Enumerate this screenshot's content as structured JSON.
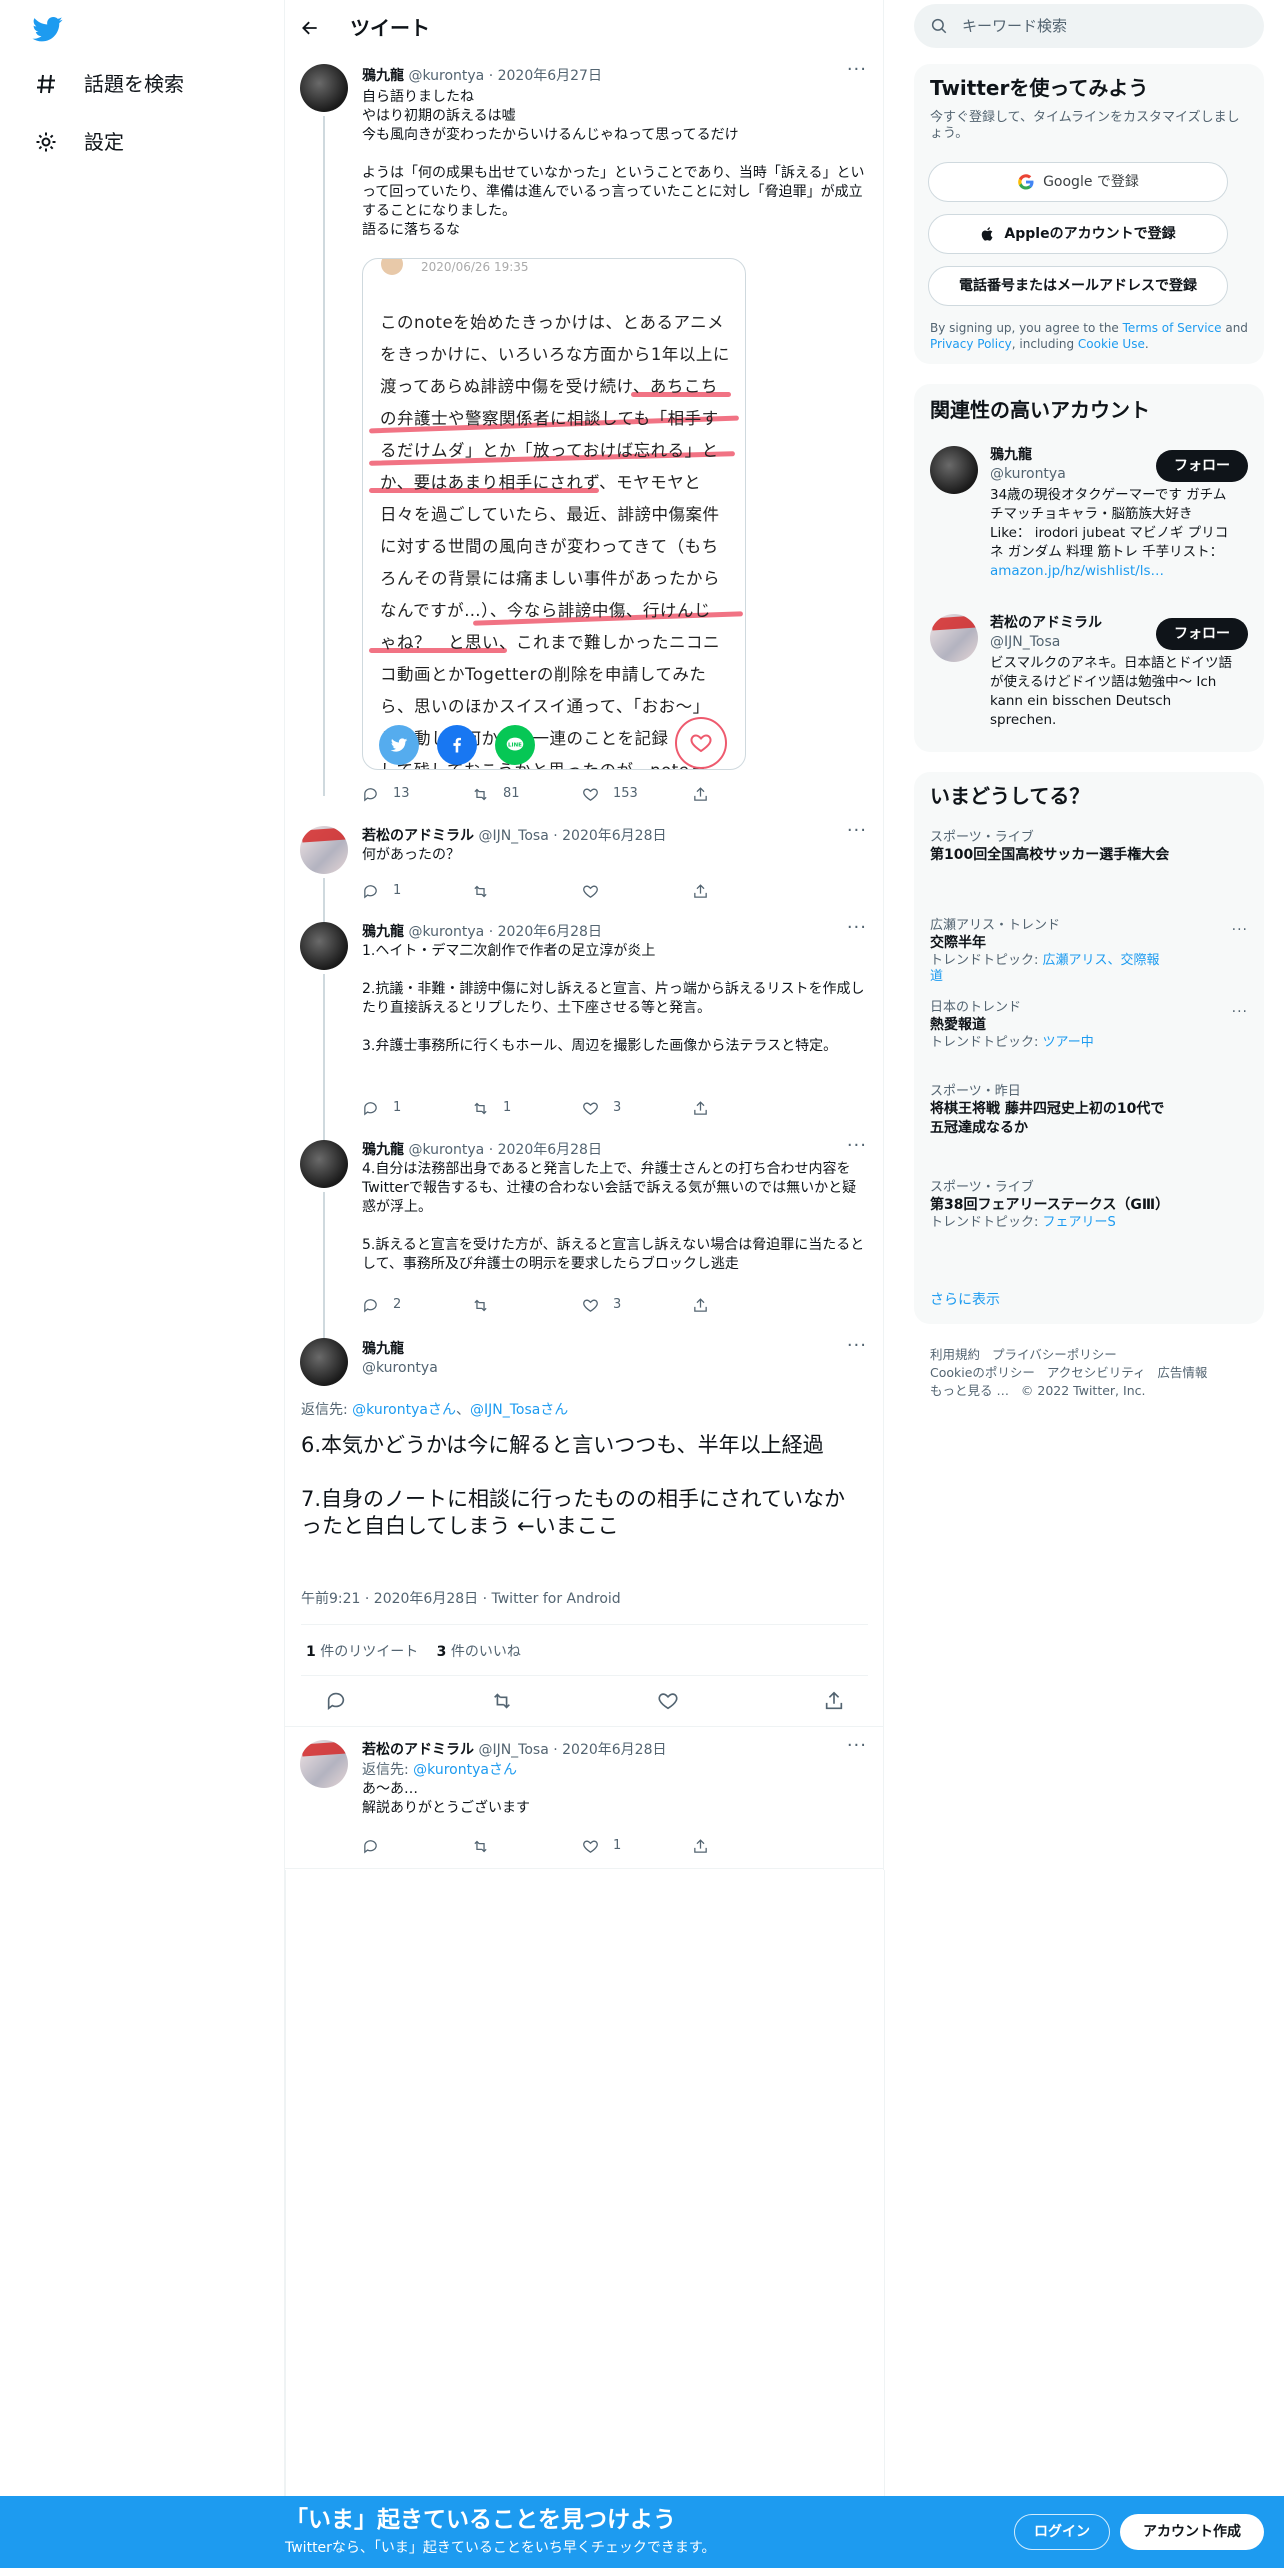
{
  "nav": {
    "explore": "話題を検索",
    "settings": "設定"
  },
  "header": {
    "title": "ツイート"
  },
  "tweet1": {
    "name": "鴉九龍",
    "handle": "@kurontya",
    "date": "· 2020年6月27日",
    "line1": "自ら語りましたね",
    "line2": "やはり初期の訴えるは嘘",
    "line3": "今も風向きが変わったからいけるんじゃねって思ってるだけ",
    "para": "ようは「何の成果も出せていなかった」ということであり、当時「訴える」といって回っていたり、準備は進んでいるっ言っていたことに対し「脅迫罪」が成立することになりました。",
    "para2": "語るに落ちるな",
    "note_date": "2020/06/26 19:35",
    "note_lines": [
      "このnoteを始めたきっかけは、とあるアニメ",
      "をきっかけに、いろいろな方面から1年以上に",
      "渡ってあらぬ誹謗中傷を受け続け、あちこち",
      "の弁護士や警察関係者に相談しても「相手す",
      "るだけムダ」とか「放っておけば忘れる」と",
      "か、要はあまり相手にされず、モヤモヤと",
      "日々を過ごしていたら、最近、誹謗中傷案件",
      "に対する世間の風向きが変わってきて（もち",
      "ろんその背景には痛ましい事件があったから",
      "なんですが…）、今なら誹謗中傷、行けんじ",
      "ゃね？　と思い、これまで難しかったニコニ",
      "コ動画とかTogetterの削除を申請してみた",
      "ら、思いのほかスイスイ通って、「おお〜」",
      "と感動して何かこの一連のことを記録",
      "して残しておこうかと思ったのが、noteを"
    ],
    "reply": "13",
    "retweet": "81",
    "like": "153"
  },
  "tweet2": {
    "name": "若松のアドミラル",
    "handle": "@IJN_Tosa",
    "date": "· 2020年6月28日",
    "text": "何があったの？",
    "reply": "1",
    "retweet": "",
    "like": ""
  },
  "tweet3": {
    "name": "鴉九龍",
    "handle": "@kurontya",
    "date": "· 2020年6月28日",
    "p1": "1.ヘイト・デマ二次創作で作者の足立淳が炎上",
    "p2": "2.抗議・非難・誹謗中傷に対し訴えると宣言、片っ端から訴えるリストを作成したり直接訴えるとリプしたり、土下座させる等と発言。",
    "p3": "3.弁護士事務所に行くもホール、周辺を撮影した画像から法テラスと特定。",
    "reply": "1",
    "retweet": "1",
    "like": "3"
  },
  "tweet4": {
    "name": "鴉九龍",
    "handle": "@kurontya",
    "date": "· 2020年6月28日",
    "p1": "4.自分は法務部出身であると発言した上で、弁護士さんとの打ち合わせ内容をTwitterで報告するも、辻褄の合わない会話で訴える気が無いのでは無いかと疑惑が浮上。",
    "p2": "5.訴えると宣言を受けた方が、訴えると宣言し訴えない場合は脅迫罪に当たるとして、事務所及び弁護士の明示を要求したらブロックし逃走",
    "reply": "2",
    "retweet": "",
    "like": "3"
  },
  "main_tweet": {
    "name": "鴉九龍",
    "handle": "@kurontya",
    "reply_to_label": "返信先: ",
    "reply_to_1": "@kurontyaさん",
    "reply_to_2": "@IJN_Tosaさん",
    "and": "、",
    "p1": "6.本気かどうかは今に解ると言いつつも、半年以上経過",
    "p2": "7.自身のノートに相談に行ったものの相手にされていなかったと自白してしまう ←いまここ",
    "timestamp": "午前9:21 · 2020年6月28日 · Twitter for Android",
    "rt_count": "1",
    "rt_label": "件のリツイート",
    "like_count": "3",
    "like_label": "件のいいね"
  },
  "tweet5": {
    "name": "若松のアドミラル",
    "handle": "@IJN_Tosa",
    "date": "· 2020年6月28日",
    "reply_to": "返信先: ",
    "reply_to_user": "@kurontyaさん",
    "l1": "あ〜あ…",
    "l2": "解説ありがとうございます",
    "reply": "",
    "retweet": "",
    "like": "1"
  },
  "search": {
    "placeholder": "キーワード検索"
  },
  "signup": {
    "title": "Twitterを使ってみよう",
    "sub": "今すぐ登録して、タイムラインをカスタマイズしましょう。",
    "google": "Google で登録",
    "apple": "Appleのアカウントで登録",
    "phone": "電話番号またはメールアドレスで登録",
    "legal_1": "By signing up, you agree to the ",
    "tos": "Terms of Service",
    "and": " and ",
    "privacy": "Privacy Policy",
    "legal_2": ", including ",
    "cookie": "Cookie Use",
    "dot": "."
  },
  "related": {
    "title": "関連性の高いアカウント",
    "follow": "フォロー",
    "a1_name": "鴉九龍",
    "a1_handle": "@kurontya",
    "a1_bio": "34歳の現役オタクゲーマーです ガチムチマッチョキャラ・脳筋族大好き Like： irodori jubeat マビノギ プリコネ ガンダム 料理 筋トレ 千芋リスト：",
    "a1_link": "amazon.jp/hz/wishlist/ls…",
    "a2_name": "若松のアドミラル",
    "a2_handle": "@IJN_Tosa",
    "a2_bio": "ビスマルクのアネキ。日本語とドイツ語が使えるけどドイツ語は勉強中〜 Ich kann ein bisschen Deutsch sprechen."
  },
  "trends": {
    "title": "いまどうしてる？",
    "t1_ctx": "スポーツ・ライブ",
    "t1_name": "第100回全国高校サッカー選手権大会",
    "t2_ctx": "広瀬アリス・トレンド",
    "t2_name": "交際半年",
    "t2_topic_label": "トレンドトピック: ",
    "t2_topic": "広瀬アリス、交際報道",
    "t3_ctx": "日本のトレンド",
    "t3_name": "熱愛報道",
    "t3_topic_label": "トレンドトピック: ",
    "t3_topic": "ツアー中",
    "t4_ctx": "スポーツ・昨日",
    "t4_name": "将棋王将戦 藤井四冠史上初の10代で五冠達成なるか",
    "t5_ctx": "スポーツ・ライブ",
    "t5_name": "第38回フェアリーステークス（GⅢ）",
    "t5_topic_label": "トレンドトピック: ",
    "t5_topic": "フェアリーS",
    "more": "さらに表示"
  },
  "footer": {
    "terms": "利用規約",
    "privacy": "プライバシーポリシー",
    "cookie": "Cookieのポリシー",
    "access": "アクセシビリティ",
    "ads": "広告情報",
    "more": "もっと見る …",
    "copy": "© 2022 Twitter, Inc."
  },
  "bottom": {
    "title": "「いま」起きていることを見つけよう",
    "sub": "Twitterなら、「いま」起きていることをいち早くチェックできます。",
    "login": "ログイン",
    "signup": "アカウント作成"
  },
  "colors": {
    "accent": "#1d9bf0",
    "text": "#0f1419",
    "muted": "#536471",
    "underline": "#ee5a6e"
  }
}
